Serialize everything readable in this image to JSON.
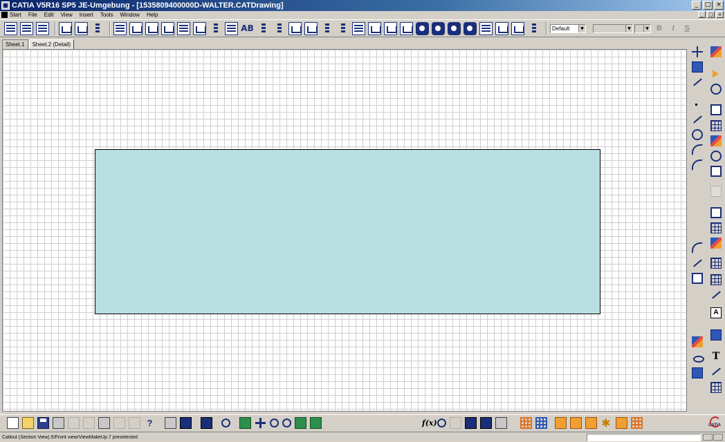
{
  "window": {
    "title": "CATIA V5R16 SP5 JE-Umgebung - [1535809400000D-WALTER.CATDrawing]",
    "minimize": "_",
    "maximize": "□",
    "close": "×"
  },
  "menubar": {
    "items": [
      "Start",
      "File",
      "Edit",
      "View",
      "Insert",
      "Tools",
      "Window",
      "Help"
    ]
  },
  "toolbar": {
    "style_combo": "Default",
    "font_combo": "",
    "size_combo": "",
    "bold": "B",
    "italic": "I",
    "underline": "S",
    "text_icon_label": "AB"
  },
  "tabs": [
    {
      "label": "Sheet.1",
      "active": false
    },
    {
      "label": "Sheet.2 (Detail)",
      "active": true
    }
  ],
  "right_toolbar": {
    "text_tool": "T",
    "textbox_tool": "A"
  },
  "bottom_toolbar": {
    "help": "?",
    "formula": "f(x)",
    "logo": "CATIA"
  },
  "statusbar": {
    "message": "Callout (Section View).5/Front view/ViewMakeUp.7 preselected",
    "command_value": ""
  },
  "colors": {
    "view_frame_fill": "#b9dfe2",
    "title_bar": "#0a246a"
  }
}
